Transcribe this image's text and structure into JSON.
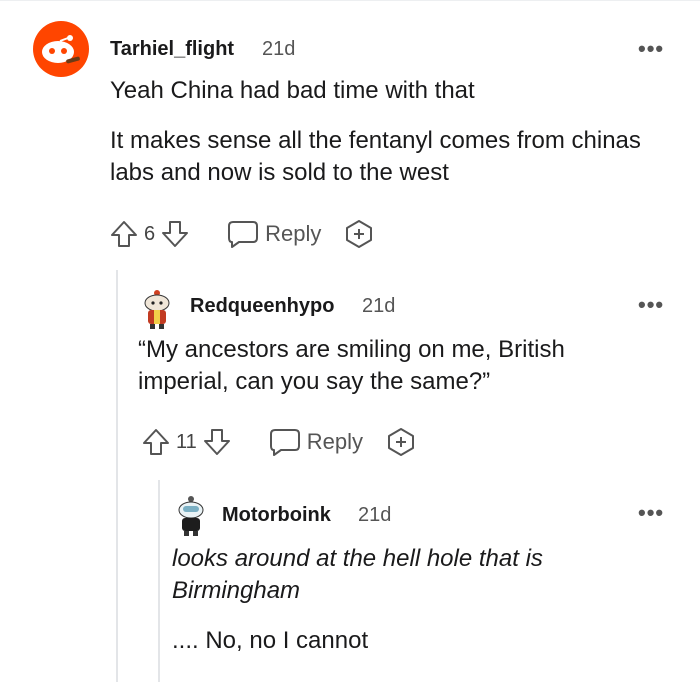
{
  "comments": [
    {
      "author": "Tarhiel_flight",
      "age": "21d",
      "body_lines": [
        "Yeah China had bad time with that",
        "It makes sense all the fentanyl comes from chinas labs and now is sold to the west"
      ],
      "votes": "6",
      "reply_label": "Reply",
      "more_label": "•••",
      "avatar_icon": "snoo-avatar-orange"
    },
    {
      "author": "Redqueenhypo",
      "age": "21d",
      "body_lines": [
        "“My ancestors are smiling on me, British imperial, can you say the same?”"
      ],
      "votes": "11",
      "reply_label": "Reply",
      "more_label": "•••",
      "avatar_icon": "snoo-avatar-custom"
    },
    {
      "author": "Motorboink",
      "age": "21d",
      "body_lines": [
        "looks around at the hell hole that is Birmingham",
        ".... No, no I cannot"
      ],
      "more_label": "•••",
      "avatar_icon": "snoo-avatar-custom"
    }
  ],
  "colors": {
    "accent_orange": "#ff4500",
    "thread_line": "#e3e5e8",
    "icon_gray": "#555555"
  }
}
